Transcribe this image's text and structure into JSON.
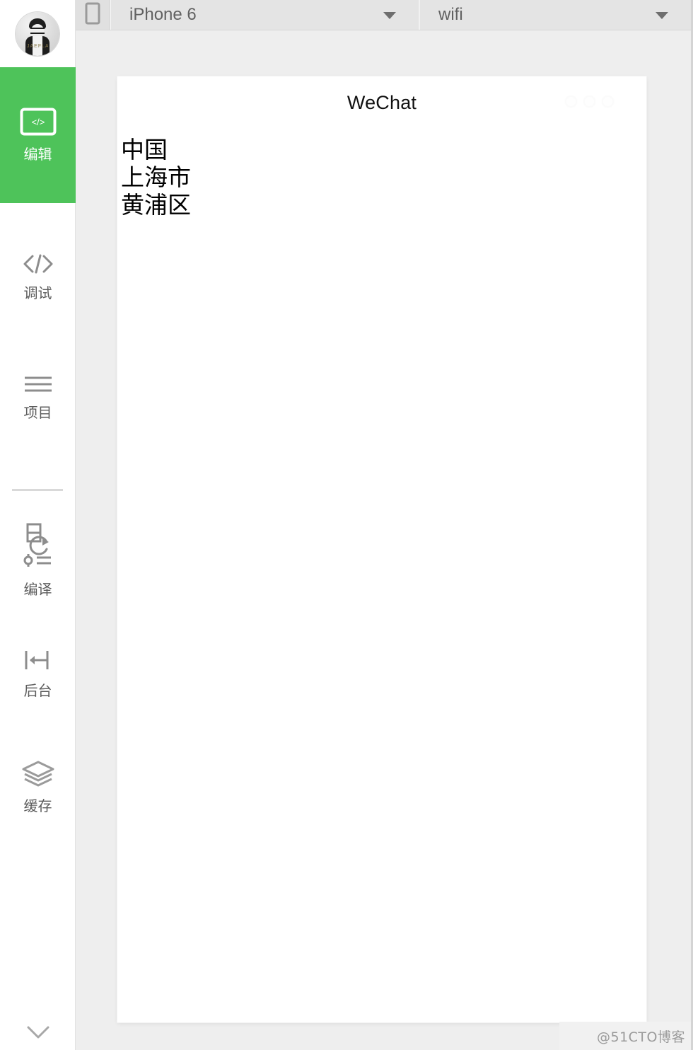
{
  "app": {
    "accent_color": "#4ec35a",
    "sidebar_bg": "#ffffff",
    "panel_bg": "#eeeeee",
    "toolbar_bg": "#e4e4e4"
  },
  "sidebar": {
    "avatar": {
      "name": "user-avatar",
      "watermark_text": "JAEFLAI"
    },
    "items": [
      {
        "id": "edit",
        "label": "编辑",
        "icon": "code-window-icon",
        "active": true
      },
      {
        "id": "debug",
        "label": "调试",
        "icon": "code-brackets-icon",
        "active": false
      },
      {
        "id": "project",
        "label": "项目",
        "icon": "hamburger-lines-icon",
        "active": false
      },
      {
        "id": "build",
        "label": "编译",
        "icon": "build-refresh-icon",
        "active": false
      },
      {
        "id": "background",
        "label": "后台",
        "icon": "background-collapse-icon",
        "active": false
      },
      {
        "id": "cache",
        "label": "缓存",
        "icon": "layers-icon",
        "active": false
      }
    ],
    "more": {
      "label": "",
      "icon": "chevron-down-icon"
    }
  },
  "toolbar": {
    "device_toggle": {
      "icon": "phone-outline-icon"
    },
    "device_select": {
      "value": "iPhone 6",
      "caret": "caret-down-icon"
    },
    "network_select": {
      "value": "wifi",
      "caret": "caret-down-icon"
    }
  },
  "simulator": {
    "header": {
      "title": "WeChat",
      "capsule": {
        "icon": "capsule-dots-icon",
        "dots": 3
      }
    },
    "page": {
      "lines": [
        "中国",
        "上海市",
        "黄浦区"
      ]
    }
  },
  "watermark": {
    "text": "@51CTO博客"
  }
}
